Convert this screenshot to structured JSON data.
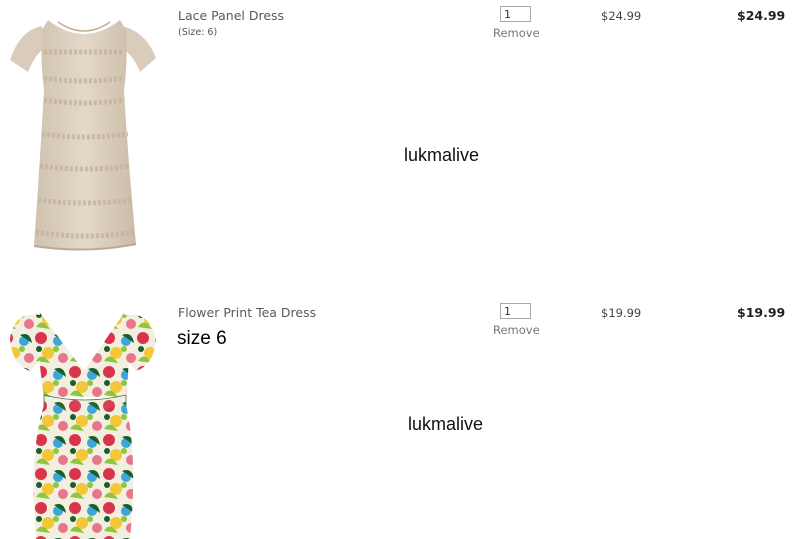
{
  "cart": {
    "items": [
      {
        "name": "Lace Panel Dress",
        "option": "(Size: 6)",
        "quantity": "1",
        "remove_label": "Remove",
        "unit_price": "$24.99",
        "total": "$24.99",
        "watermark": "lukmalive",
        "image_colors": {
          "dress": "#ddd0c0",
          "lace": "#cdbfa8"
        }
      },
      {
        "name": "Flower Print Tea Dress",
        "size_note": "size 6",
        "quantity": "1",
        "remove_label": "Remove",
        "unit_price": "$19.99",
        "total": "$19.99",
        "watermark": "lukmalive",
        "image_colors": {
          "base": "#f3efe0",
          "flowers": [
            "#d8344a",
            "#3aa7d8",
            "#8dc63f",
            "#f2c838",
            "#1a5e2e",
            "#e8768b"
          ]
        }
      }
    ]
  }
}
